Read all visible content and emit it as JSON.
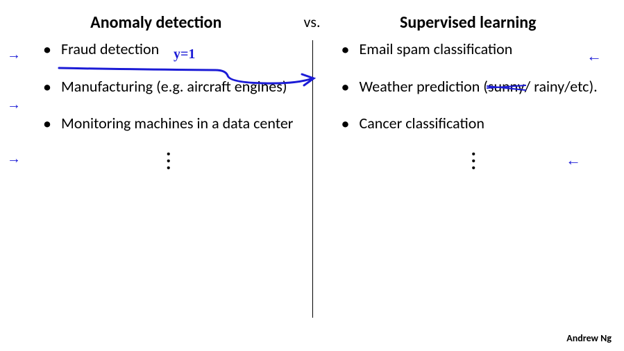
{
  "heading": {
    "left": "Anomaly detection",
    "vs": "vs.",
    "right": "Supervised learning"
  },
  "left_items": [
    "Fraud detection",
    "Manufacturing (e.g. aircraft engines)",
    "Monitoring machines in a data center"
  ],
  "right_items": [
    "Email spam classification",
    "Weather prediction (sunny/ rainy/etc).",
    "Cancer classification"
  ],
  "annotations": {
    "y_equals_1": "y=1",
    "right_arrow_glyph": "→",
    "left_arrow_glyph": "←"
  },
  "attribution": "Andrew Ng"
}
